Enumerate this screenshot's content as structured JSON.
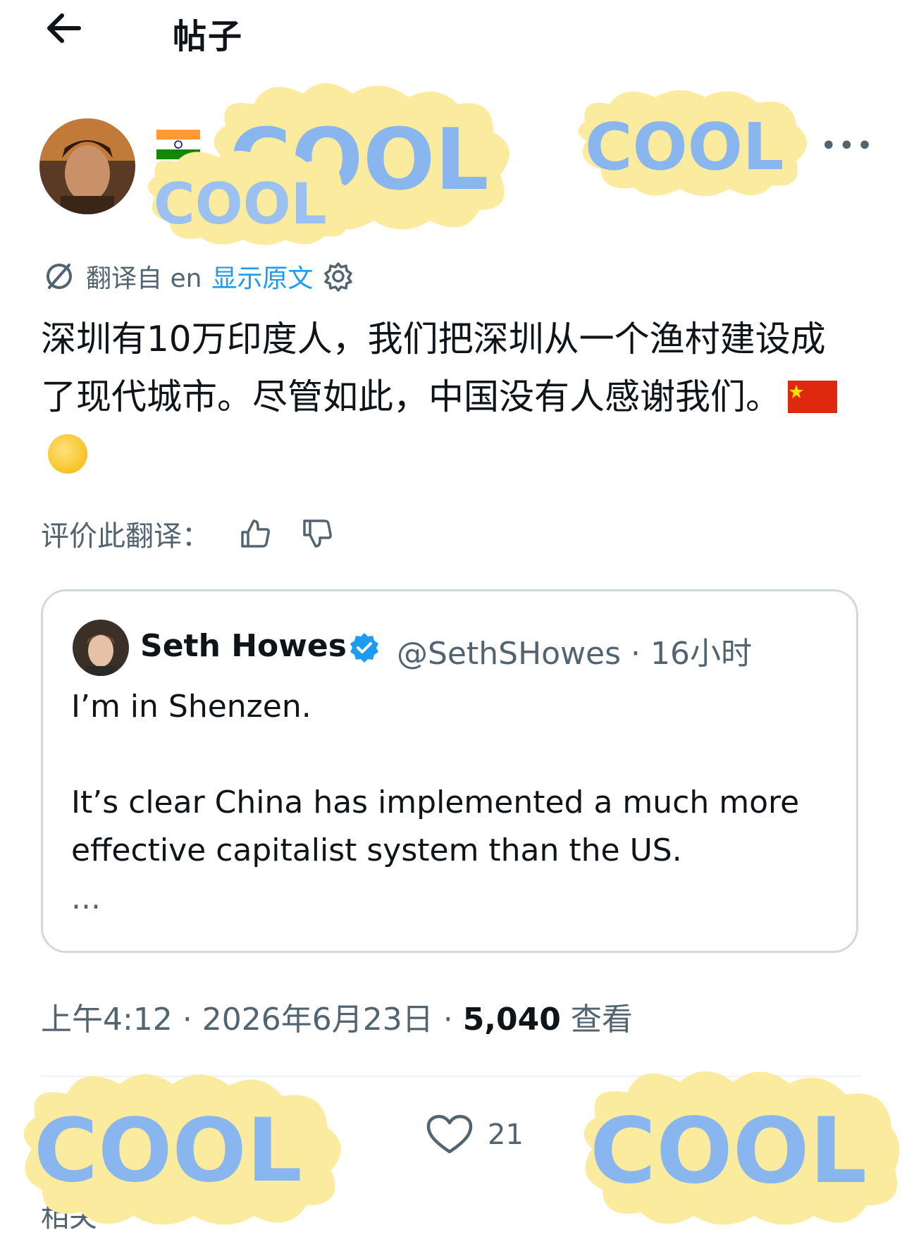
{
  "header": {
    "title": "帖子",
    "back_icon": "back-arrow-icon"
  },
  "post": {
    "translation": {
      "translated_from": "翻译自 en",
      "show_original": "显示原文"
    },
    "text": "深圳有10万印度人，我们把深圳从一个渔村建设成了现代城市。尽管如此，中国没有人感谢我们。",
    "rate_label": "评价此翻译："
  },
  "quote": {
    "name": "Seth Howes",
    "handle": "@SethSHowes · 16小时",
    "line1": "I’m in Shenzen.",
    "line2": "It’s clear China has implemented a much more effective capitalist system than the US.",
    "ellipsis": "..."
  },
  "meta": {
    "time_date": "上午4:12 · 2026年6月23日 · ",
    "views_count": "5,040",
    "views_label": " 查看"
  },
  "actions": {
    "likes": "21"
  },
  "footer": {
    "partial_text": "相关"
  },
  "sticker_text": "COOL",
  "colors": {
    "link": "#1d9bf0",
    "muted": "#536471",
    "sticker_bg": "#fbeb9f",
    "verified": "#1d9bf0"
  }
}
